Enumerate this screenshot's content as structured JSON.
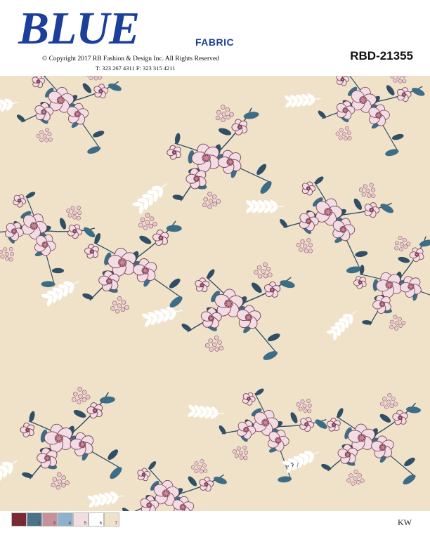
{
  "brand": {
    "name": "BLUE",
    "sub": "FABRIC",
    "copyright": "© Copyright  2017 RB  Fashion & Design  Inc. All Rights Reserved",
    "phone": "T: 323 267 4311   F: 323 315 4211"
  },
  "design_code": "RBD-21355",
  "colors": {
    "brand_blue": "#1b3f9a",
    "background": "#efe2c8",
    "leaf": "#3d6d86",
    "leaf_dark": "#2e4f66",
    "bloom": "#f1dde3",
    "bloom_edge": "#7a3d52",
    "bloom_center": "#c78596",
    "small_bloom": "#e9c9d1"
  },
  "swatches": [
    {
      "color": "#7a2a33",
      "label": "1"
    },
    {
      "color": "#4d7388",
      "label": "2"
    },
    {
      "color": "#c6919b",
      "label": "3"
    },
    {
      "color": "#8fb1cc",
      "label": "4"
    },
    {
      "color": "#f2dde0",
      "label": "5"
    },
    {
      "color": "#ffffff",
      "label": "6"
    },
    {
      "color": "#efe2c8",
      "label": "7"
    }
  ],
  "initials": "KW"
}
